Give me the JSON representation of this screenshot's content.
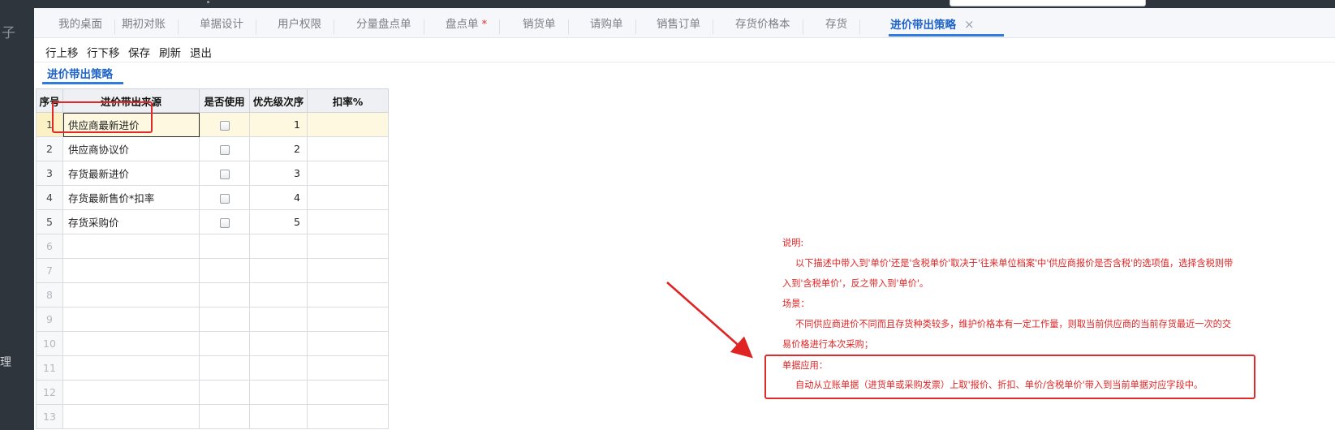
{
  "sidebar": {
    "top_glyph": "子",
    "mid_glyph": "理"
  },
  "tabs": [
    {
      "label": "我的桌面",
      "star": ""
    },
    {
      "label": "期初对账",
      "star": ""
    },
    {
      "label": "单据设计",
      "star": ""
    },
    {
      "label": "用户权限",
      "star": ""
    },
    {
      "label": "分量盘点单",
      "star": ""
    },
    {
      "label": "盘点单",
      "star": "*"
    },
    {
      "label": "销货单",
      "star": ""
    },
    {
      "label": "请购单",
      "star": ""
    },
    {
      "label": "销售订单",
      "star": ""
    },
    {
      "label": "存货价格本",
      "star": ""
    },
    {
      "label": "存货",
      "star": ""
    },
    {
      "label": "进价带出策略",
      "star": "",
      "close": "×"
    }
  ],
  "toolbar": {
    "move_up": "行上移",
    "move_down": "行下移",
    "save": "保存",
    "refresh": "刷新",
    "exit": "退出"
  },
  "section": {
    "title": "进价带出策略"
  },
  "grid": {
    "headers": {
      "idx": "序号",
      "source": "进价带出来源",
      "use": "是否使用",
      "priority": "优先级次序",
      "discount": "扣率%"
    },
    "rows": [
      {
        "idx": "1",
        "source": "供应商最新进价",
        "priority": "1",
        "discount": ""
      },
      {
        "idx": "2",
        "source": "供应商协议价",
        "priority": "2",
        "discount": ""
      },
      {
        "idx": "3",
        "source": "存货最新进价",
        "priority": "3",
        "discount": ""
      },
      {
        "idx": "4",
        "source": "存货最新售价*扣率",
        "priority": "4",
        "discount": ""
      },
      {
        "idx": "5",
        "source": "存货采购价",
        "priority": "5",
        "discount": ""
      },
      {
        "idx": "6"
      },
      {
        "idx": "7"
      },
      {
        "idx": "8"
      },
      {
        "idx": "9"
      },
      {
        "idx": "10"
      },
      {
        "idx": "11"
      },
      {
        "idx": "12"
      },
      {
        "idx": "13"
      }
    ]
  },
  "note": {
    "l1": "说明:",
    "l2": "以下描述中带入到'单价'还是'含税单价'取决于'往来单位档案'中'供应商报价是否含税'的选项值，选择含税则带",
    "l3": "入到'含税单价'，反之带入到'单价'。",
    "l4": "场景：",
    "l5": "不同供应商进价不同而且存货种类较多，维护价格本有一定工作量，则取当前供应商的当前存货最近一次的交",
    "l6": "易价格进行本次采购；",
    "l7": "单据应用：",
    "l8": "自动从立账单据（进货单或采购发票）上取'报价、折扣、单价/含税单价'带入到当前单据对应字段中。"
  },
  "colors": {
    "accent": "#1e63c8",
    "annotation_red": "#e02424",
    "selected_row": "#fdf8df"
  }
}
